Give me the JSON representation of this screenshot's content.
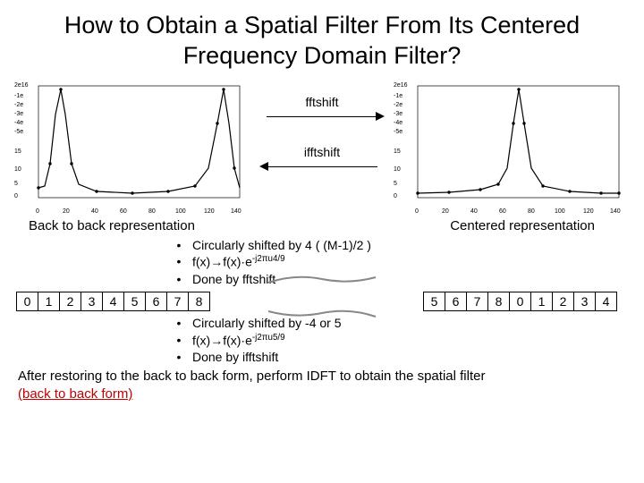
{
  "title": "How to Obtain a Spatial Filter From Its Centered Frequency Domain Filter?",
  "plots": {
    "left": {
      "ytop": "2e16",
      "y1": "-1e",
      "y2": "-2e",
      "y3": "-3e",
      "y4": "-4e",
      "y5": "-5e",
      "y6": "15",
      "y7": "10",
      "y8": "5",
      "y9": "0",
      "x0": "0",
      "x1": "20",
      "x2": "40",
      "x3": "60",
      "x4": "80",
      "x5": "100",
      "x6": "120",
      "x7": "140"
    },
    "right": {
      "ytop": "2e16",
      "y1": "-1e",
      "y2": "-2e",
      "y3": "-3e",
      "y4": "-4e",
      "y5": "-5e",
      "y6": "15",
      "y7": "10",
      "y8": "5",
      "y9": "0",
      "x0": "0",
      "x1": "20",
      "x2": "40",
      "x3": "60",
      "x4": "80",
      "x5": "100",
      "x6": "120",
      "x7": "140"
    }
  },
  "arrows": {
    "top": "fftshift",
    "bottom": "ifftshift"
  },
  "rep": {
    "left": "Back to back representation",
    "right": "Centered representation"
  },
  "bullets_top": {
    "a": "Circularly shifted by 4 ( (M-1)/2 )",
    "b_pre": "f(x)",
    "b_mid": "f(x)·e",
    "b_exp": "-j2πu4/9",
    "c": "Done by fftshift"
  },
  "boxes": {
    "left": [
      "0",
      "1",
      "2",
      "3",
      "4",
      "5",
      "6",
      "7",
      "8"
    ],
    "right": [
      "5",
      "6",
      "7",
      "8",
      "0",
      "1",
      "2",
      "3",
      "4"
    ]
  },
  "bullets_bot": {
    "a": "Circularly shifted by -4 or 5",
    "b_pre": "f(x)",
    "b_mid": "f(x)·e",
    "b_exp": "-j2πu5/9",
    "c": "Done by ifftshift"
  },
  "footer": {
    "line1": "After restoring to the back to back form, perform IDFT to obtain the spatial filter ",
    "line2": "(back to back form)"
  }
}
